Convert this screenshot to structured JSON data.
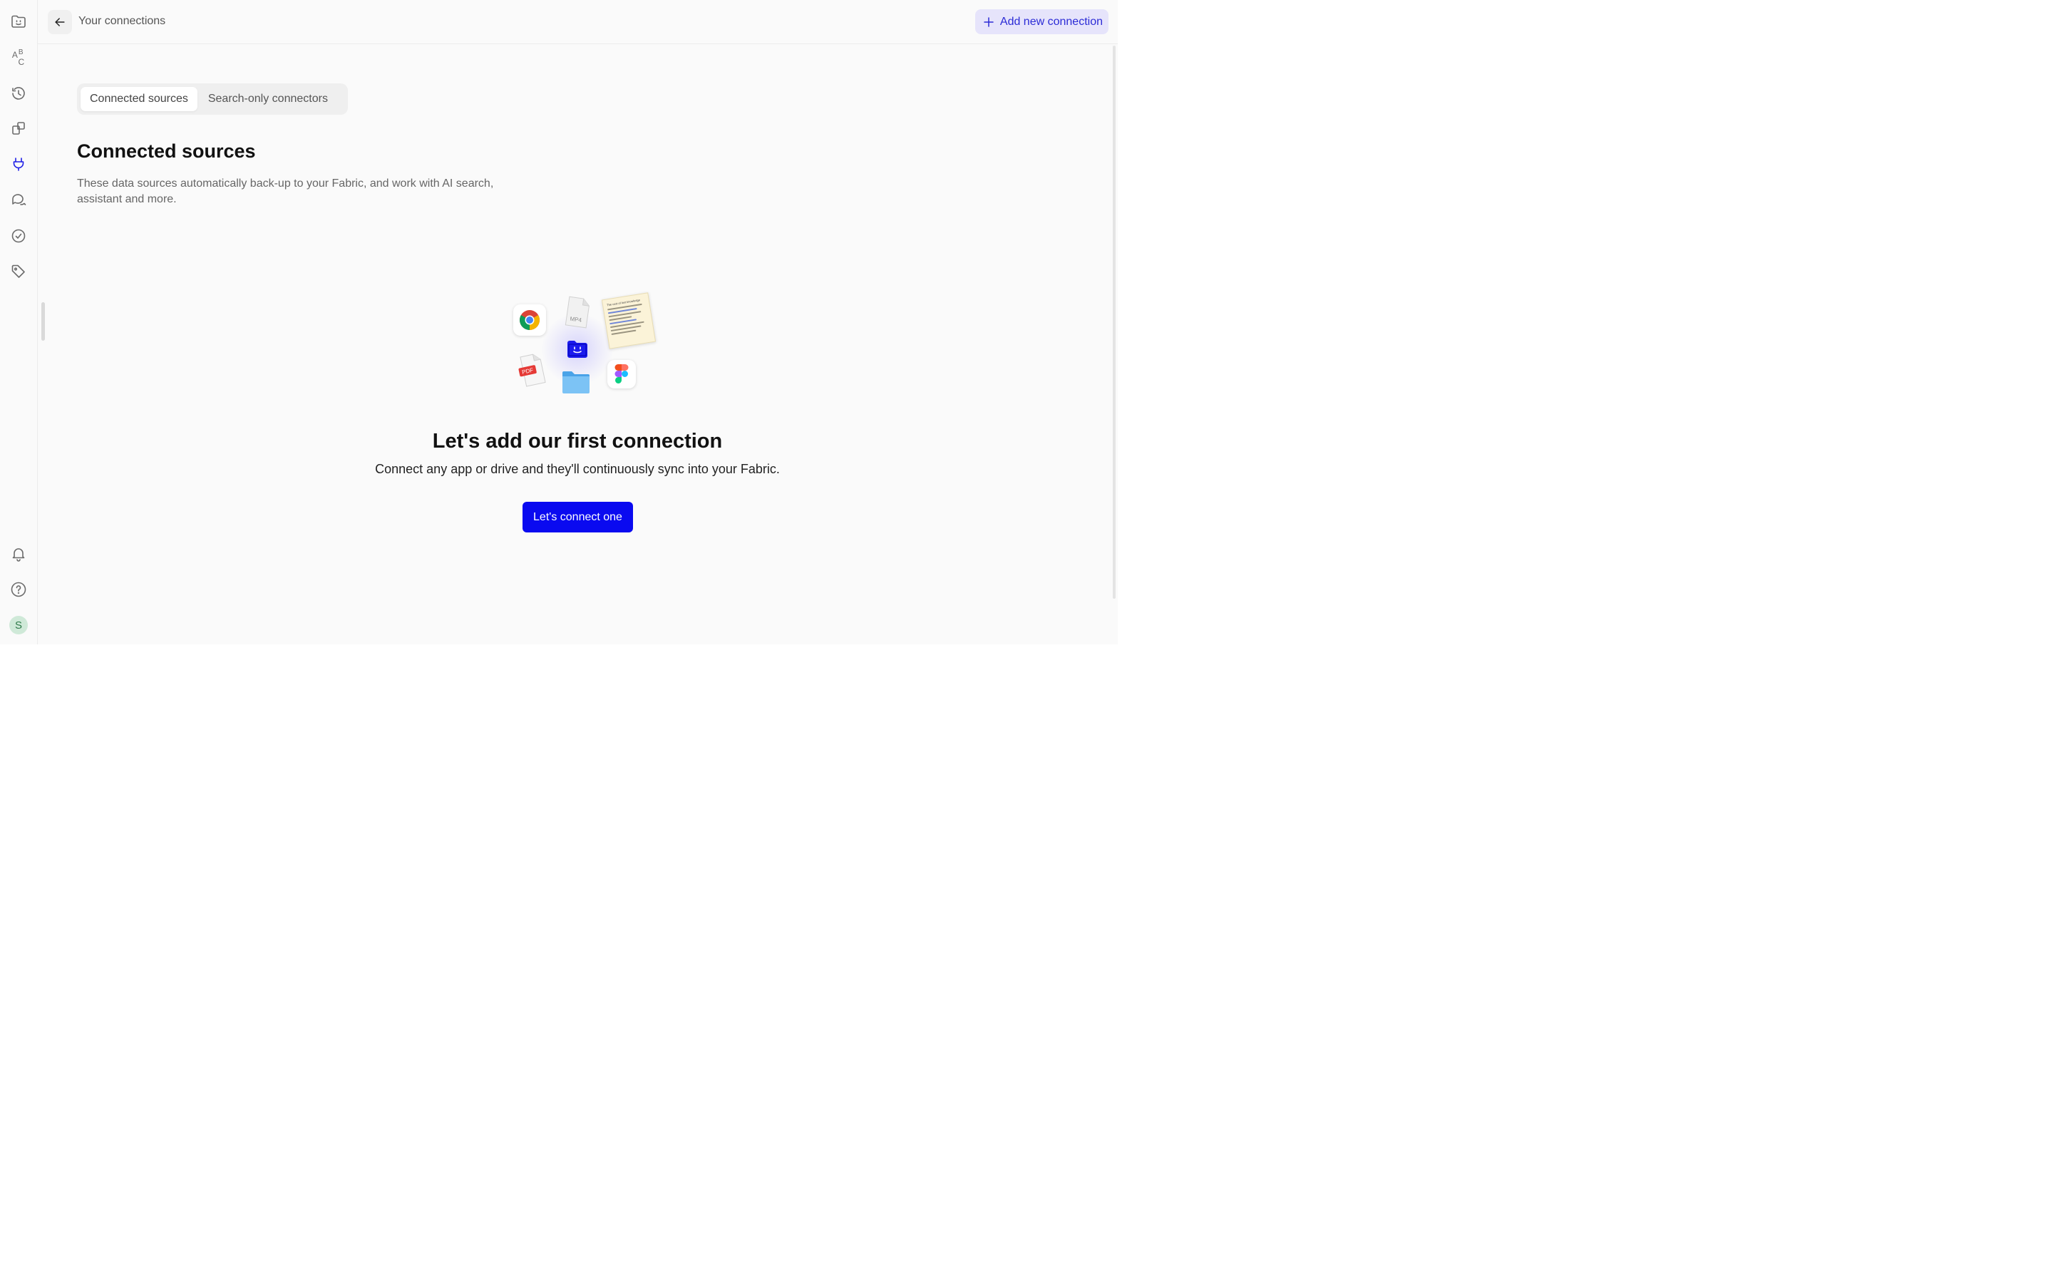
{
  "header": {
    "breadcrumb": "Your connections",
    "add_button_label": "Add new connection"
  },
  "sidebar": {
    "items": [
      {
        "name": "fabric-home",
        "icon": "fabric-logo-icon"
      },
      {
        "name": "fonts",
        "icon": "abc-icon"
      },
      {
        "name": "history",
        "icon": "history-icon"
      },
      {
        "name": "spaces",
        "icon": "stack-icon"
      },
      {
        "name": "connections",
        "icon": "plug-icon",
        "active": true
      },
      {
        "name": "chat",
        "icon": "chat-icon"
      },
      {
        "name": "tasks",
        "icon": "check-circle-icon"
      },
      {
        "name": "tags",
        "icon": "tag-icon"
      }
    ],
    "bottom": [
      {
        "name": "notifications",
        "icon": "bell-icon"
      },
      {
        "name": "help",
        "icon": "help-icon"
      }
    ],
    "avatar_initial": "S",
    "accent_color": "#1f1fe6"
  },
  "tabs": [
    {
      "label": "Connected sources",
      "active": true
    },
    {
      "label": "Search-only connectors",
      "active": false
    }
  ],
  "section": {
    "title": "Connected sources",
    "description": "These data sources automatically back-up to your Fabric, and work with AI search, assistant and more."
  },
  "illustration": {
    "mp4_label": "MP4",
    "pdf_label": "PDF",
    "note_title": "The cost of lost knowledge",
    "icons": [
      "chrome-icon",
      "mp4-file-icon",
      "note-document-icon",
      "fabric-icon",
      "pdf-file-icon",
      "folder-icon",
      "figma-icon"
    ]
  },
  "empty_state": {
    "title": "Let's add our first connection",
    "subtitle": "Connect any app or drive and they'll continuously sync into your Fabric.",
    "cta_label": "Let's connect one",
    "cta_color": "#0a0af0"
  }
}
